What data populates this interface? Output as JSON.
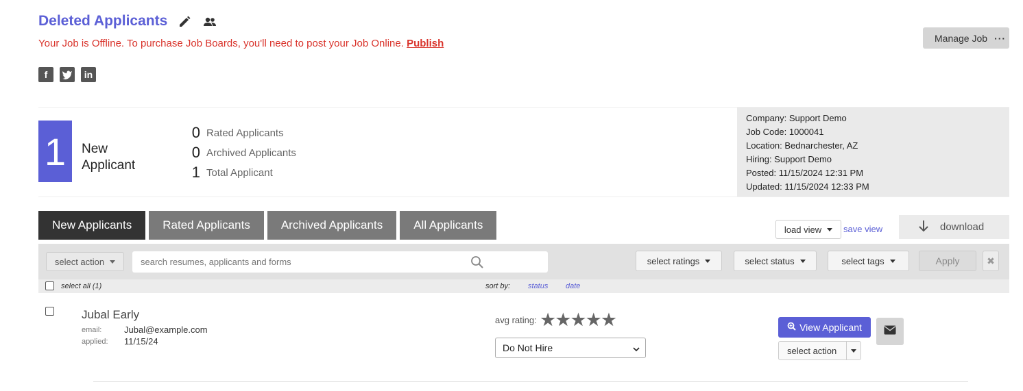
{
  "header": {
    "title": "Deleted Applicants",
    "offline_message": "Your Job is Offline. To purchase Job Boards, you'll need to post your Job Online.",
    "publish_link": "Publish",
    "manage_job": "Manage Job",
    "social_icons": [
      "facebook-icon",
      "twitter-icon",
      "linkedin-icon"
    ]
  },
  "stats": {
    "new_count": "1",
    "new_label": "New Applicant",
    "rows": [
      {
        "count": "0",
        "label": "Rated Applicants"
      },
      {
        "count": "0",
        "label": "Archived Applicants"
      },
      {
        "count": "1",
        "label": "Total Applicant"
      }
    ]
  },
  "job_info": {
    "company": "Company: Support Demo",
    "job_code": "Job Code: 1000041",
    "location": "Location: Bednarchester, AZ",
    "hiring": "Hiring: Support Demo",
    "posted": "Posted: 11/15/2024 12:31 PM",
    "updated": "Updated: 11/15/2024 12:33 PM"
  },
  "tabs": [
    "New Applicants",
    "Rated Applicants",
    "Archived Applicants",
    "All Applicants"
  ],
  "view": {
    "load_view": "load view",
    "save_view": "save view",
    "download": "download"
  },
  "filters": {
    "select_action": "select action",
    "search_placeholder": "search resumes, applicants and forms",
    "select_ratings": "select ratings",
    "select_status": "select status",
    "select_tags": "select tags",
    "apply": "Apply",
    "clear": "✖"
  },
  "list_bar": {
    "select_all": "select all (1)",
    "sort_by": "sort by:",
    "sort_status": "status",
    "sort_date": "date"
  },
  "applicant": {
    "name": "Jubal Early",
    "email_label": "email:",
    "email": "Jubal@example.com",
    "applied_label": "applied:",
    "applied": "11/15/24",
    "avg_rating_label": "avg rating:",
    "stars": "★★★★★",
    "status": "Do Not Hire",
    "view_button": "View Applicant",
    "select_action": "select action"
  },
  "colors": {
    "accent": "#5b5fd6",
    "warning": "#d9332b",
    "tab_active": "#333333",
    "tab_inactive": "#7a7a7a"
  }
}
